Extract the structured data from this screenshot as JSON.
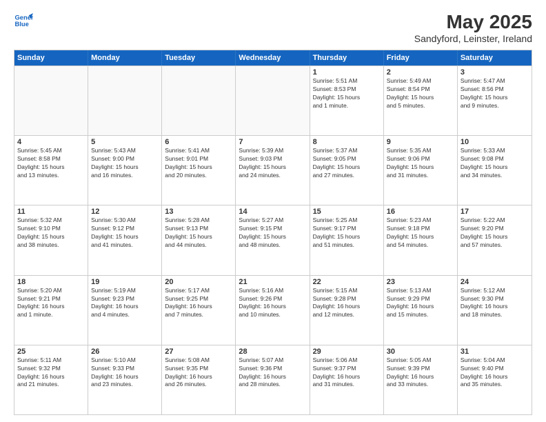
{
  "logo": {
    "line1": "General",
    "line2": "Blue"
  },
  "title": "May 2025",
  "subtitle": "Sandyford, Leinster, Ireland",
  "header": {
    "days": [
      "Sunday",
      "Monday",
      "Tuesday",
      "Wednesday",
      "Thursday",
      "Friday",
      "Saturday"
    ]
  },
  "weeks": [
    [
      {
        "day": "",
        "info": ""
      },
      {
        "day": "",
        "info": ""
      },
      {
        "day": "",
        "info": ""
      },
      {
        "day": "",
        "info": ""
      },
      {
        "day": "1",
        "info": "Sunrise: 5:51 AM\nSunset: 8:53 PM\nDaylight: 15 hours\nand 1 minute."
      },
      {
        "day": "2",
        "info": "Sunrise: 5:49 AM\nSunset: 8:54 PM\nDaylight: 15 hours\nand 5 minutes."
      },
      {
        "day": "3",
        "info": "Sunrise: 5:47 AM\nSunset: 8:56 PM\nDaylight: 15 hours\nand 9 minutes."
      }
    ],
    [
      {
        "day": "4",
        "info": "Sunrise: 5:45 AM\nSunset: 8:58 PM\nDaylight: 15 hours\nand 13 minutes."
      },
      {
        "day": "5",
        "info": "Sunrise: 5:43 AM\nSunset: 9:00 PM\nDaylight: 15 hours\nand 16 minutes."
      },
      {
        "day": "6",
        "info": "Sunrise: 5:41 AM\nSunset: 9:01 PM\nDaylight: 15 hours\nand 20 minutes."
      },
      {
        "day": "7",
        "info": "Sunrise: 5:39 AM\nSunset: 9:03 PM\nDaylight: 15 hours\nand 24 minutes."
      },
      {
        "day": "8",
        "info": "Sunrise: 5:37 AM\nSunset: 9:05 PM\nDaylight: 15 hours\nand 27 minutes."
      },
      {
        "day": "9",
        "info": "Sunrise: 5:35 AM\nSunset: 9:06 PM\nDaylight: 15 hours\nand 31 minutes."
      },
      {
        "day": "10",
        "info": "Sunrise: 5:33 AM\nSunset: 9:08 PM\nDaylight: 15 hours\nand 34 minutes."
      }
    ],
    [
      {
        "day": "11",
        "info": "Sunrise: 5:32 AM\nSunset: 9:10 PM\nDaylight: 15 hours\nand 38 minutes."
      },
      {
        "day": "12",
        "info": "Sunrise: 5:30 AM\nSunset: 9:12 PM\nDaylight: 15 hours\nand 41 minutes."
      },
      {
        "day": "13",
        "info": "Sunrise: 5:28 AM\nSunset: 9:13 PM\nDaylight: 15 hours\nand 44 minutes."
      },
      {
        "day": "14",
        "info": "Sunrise: 5:27 AM\nSunset: 9:15 PM\nDaylight: 15 hours\nand 48 minutes."
      },
      {
        "day": "15",
        "info": "Sunrise: 5:25 AM\nSunset: 9:17 PM\nDaylight: 15 hours\nand 51 minutes."
      },
      {
        "day": "16",
        "info": "Sunrise: 5:23 AM\nSunset: 9:18 PM\nDaylight: 15 hours\nand 54 minutes."
      },
      {
        "day": "17",
        "info": "Sunrise: 5:22 AM\nSunset: 9:20 PM\nDaylight: 15 hours\nand 57 minutes."
      }
    ],
    [
      {
        "day": "18",
        "info": "Sunrise: 5:20 AM\nSunset: 9:21 PM\nDaylight: 16 hours\nand 1 minute."
      },
      {
        "day": "19",
        "info": "Sunrise: 5:19 AM\nSunset: 9:23 PM\nDaylight: 16 hours\nand 4 minutes."
      },
      {
        "day": "20",
        "info": "Sunrise: 5:17 AM\nSunset: 9:25 PM\nDaylight: 16 hours\nand 7 minutes."
      },
      {
        "day": "21",
        "info": "Sunrise: 5:16 AM\nSunset: 9:26 PM\nDaylight: 16 hours\nand 10 minutes."
      },
      {
        "day": "22",
        "info": "Sunrise: 5:15 AM\nSunset: 9:28 PM\nDaylight: 16 hours\nand 12 minutes."
      },
      {
        "day": "23",
        "info": "Sunrise: 5:13 AM\nSunset: 9:29 PM\nDaylight: 16 hours\nand 15 minutes."
      },
      {
        "day": "24",
        "info": "Sunrise: 5:12 AM\nSunset: 9:30 PM\nDaylight: 16 hours\nand 18 minutes."
      }
    ],
    [
      {
        "day": "25",
        "info": "Sunrise: 5:11 AM\nSunset: 9:32 PM\nDaylight: 16 hours\nand 21 minutes."
      },
      {
        "day": "26",
        "info": "Sunrise: 5:10 AM\nSunset: 9:33 PM\nDaylight: 16 hours\nand 23 minutes."
      },
      {
        "day": "27",
        "info": "Sunrise: 5:08 AM\nSunset: 9:35 PM\nDaylight: 16 hours\nand 26 minutes."
      },
      {
        "day": "28",
        "info": "Sunrise: 5:07 AM\nSunset: 9:36 PM\nDaylight: 16 hours\nand 28 minutes."
      },
      {
        "day": "29",
        "info": "Sunrise: 5:06 AM\nSunset: 9:37 PM\nDaylight: 16 hours\nand 31 minutes."
      },
      {
        "day": "30",
        "info": "Sunrise: 5:05 AM\nSunset: 9:39 PM\nDaylight: 16 hours\nand 33 minutes."
      },
      {
        "day": "31",
        "info": "Sunrise: 5:04 AM\nSunset: 9:40 PM\nDaylight: 16 hours\nand 35 minutes."
      }
    ]
  ]
}
